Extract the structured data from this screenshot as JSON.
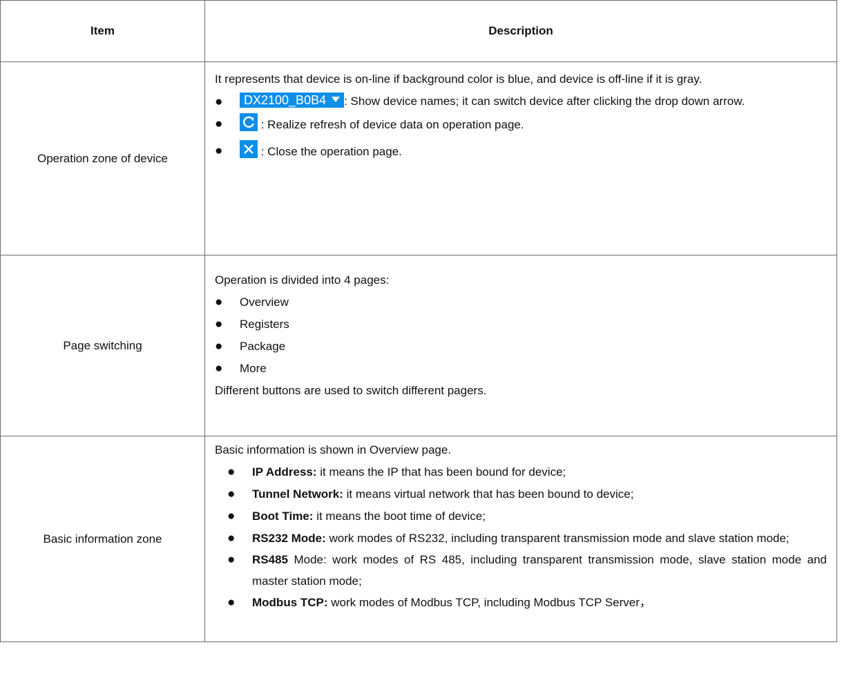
{
  "header": {
    "item": "Item",
    "description": "Description"
  },
  "rows": [
    {
      "item": "Operation zone of device",
      "intro": "It represents that device is on-line if background color is blue, and device is off-line if it is gray.",
      "device_tag": "DX2100_B0B4",
      "bullet1_text": ": Show device names; it can switch device after clicking the drop down arrow.",
      "refresh_text": ": Realize refresh of device data on operation page.",
      "close_text": ": Close the operation page."
    },
    {
      "item": "Page switching",
      "intro": "Operation is divided into 4 pages:",
      "pages": [
        "Overview",
        "Registers",
        "Package",
        "More"
      ],
      "outro": "Different buttons are used to switch different pagers."
    },
    {
      "item": "Basic information zone",
      "intro": "Basic information is shown in Overview page.",
      "fields": [
        {
          "label": "IP Address:",
          "text": " it means the IP that has been bound for device;"
        },
        {
          "label": "Tunnel Network:",
          "text": " it means virtual network that has been bound to device;"
        },
        {
          "label": "Boot Time:",
          "text": " it means the boot time of device;"
        },
        {
          "label": "RS232 Mode:",
          "text": " work modes of RS232, including transparent transmission mode and slave station mode;"
        },
        {
          "label": "RS485",
          "text": " Mode: work modes of RS 485, including transparent transmission mode, slave station mode and master station mode;"
        },
        {
          "label": "Modbus TCP:",
          "text": " work modes of Modbus TCP, including Modbus TCP Server，"
        }
      ]
    }
  ],
  "icons": {
    "dropdown": "dropdown-triangle-icon",
    "refresh": "refresh-icon",
    "close": "close-icon",
    "bullet": "bullet-dot-icon"
  },
  "colors": {
    "accent": "#0d8ee9",
    "border": "#6a6a6a"
  }
}
